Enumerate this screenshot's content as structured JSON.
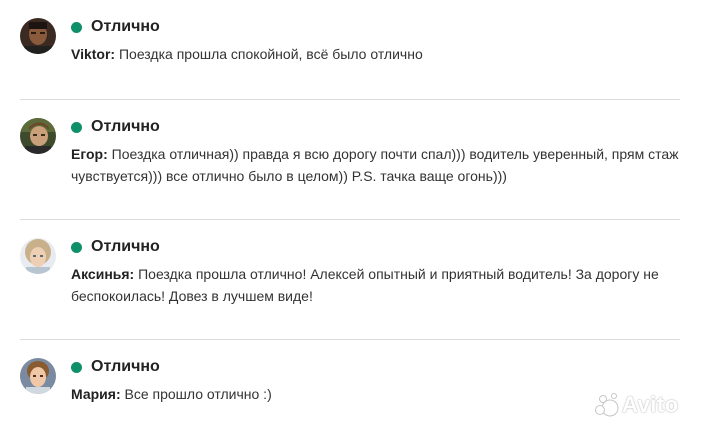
{
  "reviews": [
    {
      "rating_label": "Отлично",
      "author": "Viktor:",
      "text": " Поездка прошла спокойной, всё было отлично"
    },
    {
      "rating_label": "Отлично",
      "author": "Егор:",
      "text": " Поездка отличная)) правда я всю дорогу почти спал))) водитель уверенный, прям стаж чувствуется))) все отлично было в целом)) P.S. тачка ваще огонь)))"
    },
    {
      "rating_label": "Отлично",
      "author": "Аксинья:",
      "text": " Поездка прошла отлично! Алексей опытный и приятный водитель! За дорогу не беспокоилась! Довез в лучшем виде!"
    },
    {
      "rating_label": "Отлично",
      "author": "Мария:",
      "text": " Все прошло отлично :)"
    }
  ],
  "watermark": {
    "text": "Avito",
    "icon": "avito-logo-icon"
  },
  "colors": {
    "rating_dot": "#0f8f6a",
    "divider": "#dcdcdc",
    "text": "#333333"
  }
}
